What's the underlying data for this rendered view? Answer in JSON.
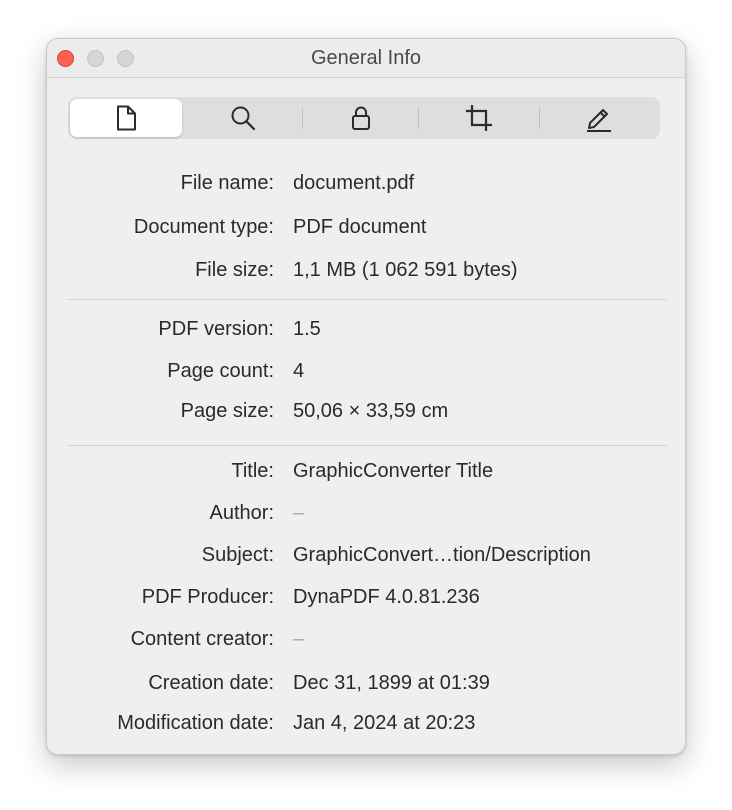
{
  "window": {
    "title": "General Info"
  },
  "toolbar": {
    "tabs": [
      {
        "icon": "document-icon",
        "active": true
      },
      {
        "icon": "magnifier-icon",
        "active": false
      },
      {
        "icon": "lock-icon",
        "active": false
      },
      {
        "icon": "crop-icon",
        "active": false
      },
      {
        "icon": "pencil-icon",
        "active": false
      }
    ]
  },
  "sections": {
    "file": [
      {
        "label": "File name:",
        "value": "document.pdf"
      },
      {
        "label": "Document type:",
        "value": "PDF document"
      },
      {
        "label": "File size:",
        "value": "1,1 MB (1 062 591 bytes)"
      }
    ],
    "pdf": [
      {
        "label": "PDF version:",
        "value": "1.5"
      },
      {
        "label": "Page count:",
        "value": "4"
      },
      {
        "label": "Page size:",
        "value": "50,06 × 33,59 cm"
      }
    ],
    "meta": [
      {
        "label": "Title:",
        "value": "GraphicConverter Title"
      },
      {
        "label": "Author:",
        "value": "–"
      },
      {
        "label": "Subject:",
        "value": "GraphicConvert…tion/Description"
      },
      {
        "label": "PDF Producer:",
        "value": "DynaPDF 4.0.81.236"
      },
      {
        "label": "Content creator:",
        "value": "–"
      },
      {
        "label": "Creation date:",
        "value": "Dec 31, 1899 at 01:39"
      },
      {
        "label": "Modification date:",
        "value": "Jan 4, 2024 at 20:23"
      }
    ]
  },
  "colors": {
    "close": "#fe5f57",
    "window_bg": "#efefef",
    "text": "#2a2a2a",
    "muted": "#a8a8a8"
  }
}
